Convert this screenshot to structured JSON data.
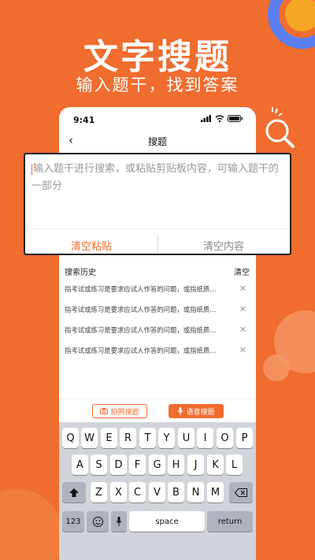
{
  "hero": {
    "title": "文字搜题",
    "subtitle": "输入题干，找到答案"
  },
  "status": {
    "time": "9:41"
  },
  "nav": {
    "back_icon": "‹",
    "title": "搜题"
  },
  "input": {
    "placeholder": "输入题干进行搜索，或粘贴剪贴板内容，可输入题干的一部分",
    "paste_label": "清空粘贴",
    "clear_label": "清空内容"
  },
  "history": {
    "title": "搜索历史",
    "clear_label": "清空",
    "items": [
      "指考试或练习是要求应试人作答的问题，或指纸质...",
      "指考试或练习是要求应试人作答的问题，或指纸质...",
      "指考试或练习是要求应试人作答的问题，或指纸质...",
      "指考试或练习是要求应试人作答的问题，或指纸质..."
    ]
  },
  "toolbar": {
    "photo_label": "拍照搜题",
    "voice_label": "语音搜题"
  },
  "keyboard": {
    "row1": [
      "Q",
      "W",
      "E",
      "R",
      "T",
      "Y",
      "U",
      "I",
      "O",
      "P"
    ],
    "row2": [
      "A",
      "S",
      "D",
      "F",
      "G",
      "H",
      "J",
      "K",
      "L"
    ],
    "row3": [
      "Z",
      "X",
      "C",
      "V",
      "B",
      "N",
      "M"
    ],
    "numbers": "123",
    "space": "space",
    "return": "return"
  },
  "colors": {
    "accent": "#f06c2f",
    "ring": "#5b7ef0"
  }
}
